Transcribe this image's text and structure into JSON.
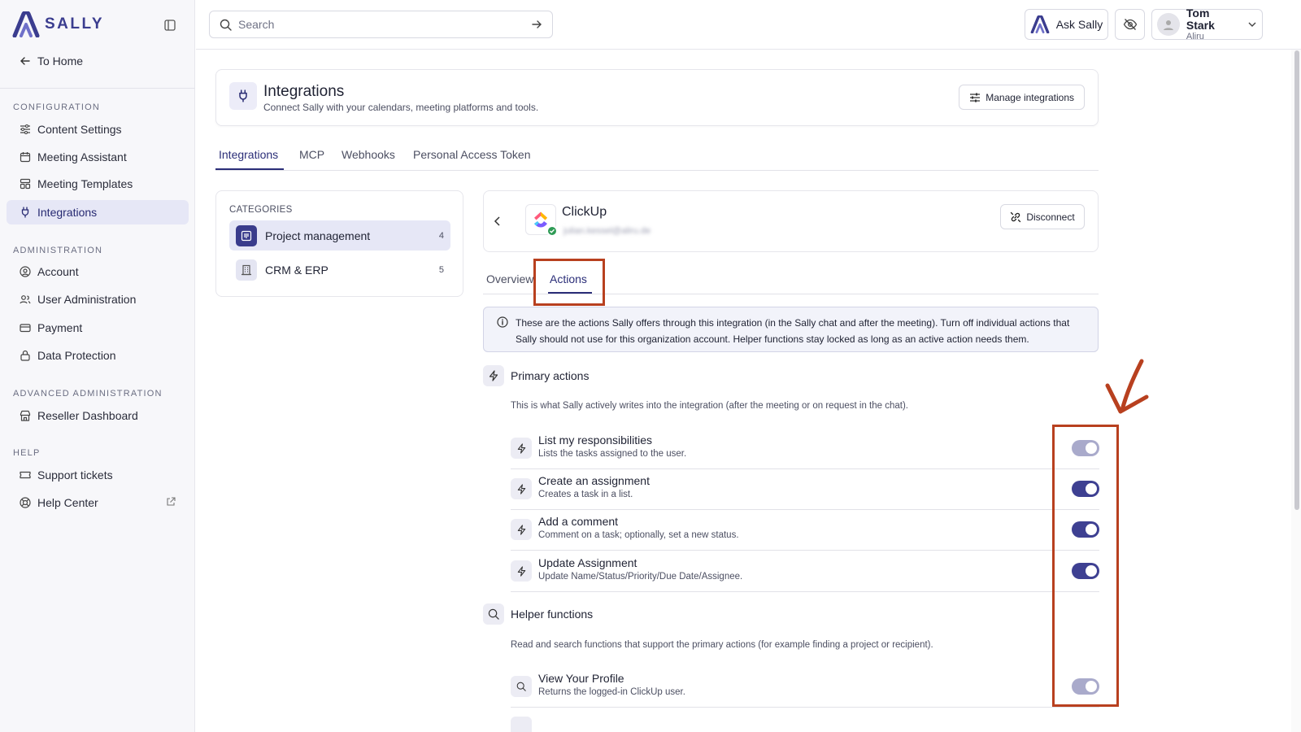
{
  "sidebar": {
    "brand": "SALLY",
    "to_home": "To Home",
    "sections": [
      {
        "label": "CONFIGURATION"
      },
      {
        "label": "ADMINISTRATION"
      },
      {
        "label": "ADVANCED ADMINISTRATION"
      },
      {
        "label": "HELP"
      }
    ],
    "items": {
      "content_settings": "Content Settings",
      "meeting_assistant": "Meeting Assistant",
      "meeting_templates": "Meeting Templates",
      "integrations": "Integrations",
      "account": "Account",
      "user_administration": "User Administration",
      "payment": "Payment",
      "data_protection": "Data Protection",
      "reseller_dashboard": "Reseller Dashboard",
      "support_tickets": "Support tickets",
      "help_center": "Help Center"
    },
    "active_item": "Integrations"
  },
  "topbar": {
    "search_placeholder": "Search",
    "ask_label": "Ask Sally",
    "user_name": "Tom Stark",
    "user_org": "Aliru"
  },
  "header": {
    "title": "Integrations",
    "subtitle": "Connect Sally with your calendars, meeting platforms and tools.",
    "manage_label": "Manage integrations"
  },
  "main_tabs": [
    "Integrations",
    "MCP",
    "Webhooks",
    "Personal Access Token"
  ],
  "active_main_tab": "Integrations",
  "categories": {
    "label": "CATEGORIES",
    "items": [
      {
        "label": "Project management",
        "count": "4"
      },
      {
        "label": "CRM & ERP",
        "count": "5"
      }
    ]
  },
  "integration": {
    "name": "ClickUp",
    "account_email": "julian.kessel@aliru.de",
    "disconnect_label": "Disconnect"
  },
  "sub_tabs": [
    "Overview",
    "Actions"
  ],
  "active_sub_tab": "Actions",
  "info_text": "These are the actions Sally offers through this integration (in the Sally chat and after the meeting). Turn off individual actions that Sally should not use for this organization account. Helper functions stay locked as long as an active action needs them.",
  "primary": {
    "title": "Primary actions",
    "description": "This is what Sally actively writes into the integration (after the meeting or on request in the chat).",
    "actions": [
      {
        "title": "List my responsibilities",
        "description": "Lists the tasks assigned to the user.",
        "enabled": true,
        "locked": true
      },
      {
        "title": "Create an assignment",
        "description": "Creates a task in a list.",
        "enabled": true,
        "locked": false
      },
      {
        "title": "Add a comment",
        "description": "Comment on a task; optionally, set a new status.",
        "enabled": true,
        "locked": false
      },
      {
        "title": "Update Assignment",
        "description": "Update Name/Status/Priority/Due Date/Assignee.",
        "enabled": true,
        "locked": false
      }
    ]
  },
  "helper": {
    "title": "Helper functions",
    "description": "Read and search functions that support the primary actions (for example finding a project or recipient).",
    "actions": [
      {
        "title": "View Your Profile",
        "description": "Returns the logged-in ClickUp user.",
        "enabled": true,
        "locked": true
      }
    ]
  },
  "colors": {
    "accent": "#2b2e78",
    "toggle_on": "#3e4092",
    "toggle_locked": "#a9aacb",
    "annotation": "#b8401f",
    "connected": "#2e9b55"
  }
}
